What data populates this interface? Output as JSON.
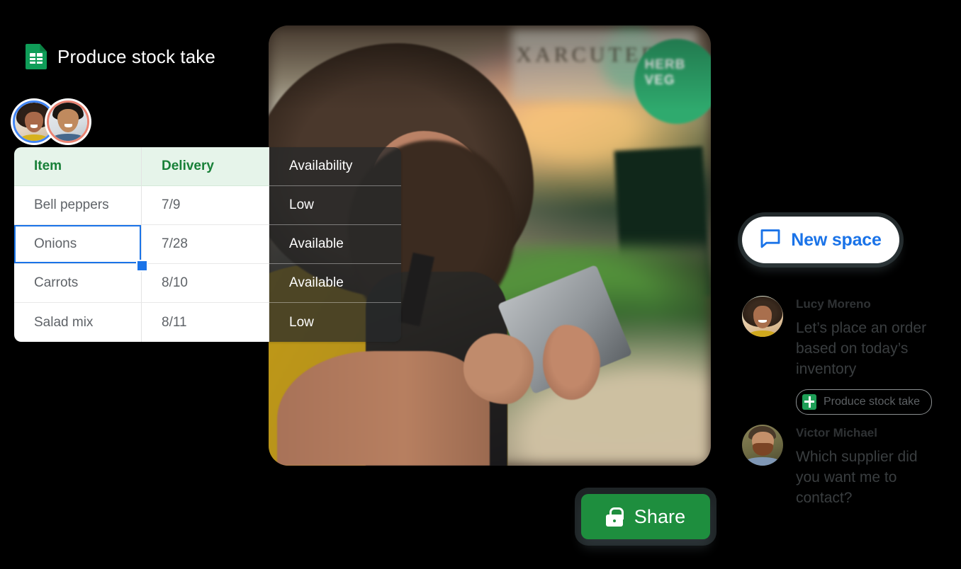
{
  "document": {
    "icon": "google-sheets-icon",
    "title": "Produce stock take"
  },
  "sheet": {
    "columns": [
      "Item",
      "Delivery",
      "Availability"
    ],
    "rows": [
      {
        "item": "Bell peppers",
        "delivery": "7/9",
        "availability": "Low"
      },
      {
        "item": "Onions",
        "delivery": "7/28",
        "availability": "Available"
      },
      {
        "item": "Carrots",
        "delivery": "8/10",
        "availability": "Available"
      },
      {
        "item": "Salad mix",
        "delivery": "8/11",
        "availability": "Low"
      }
    ],
    "selected_row_index": 1,
    "selection_color": "#1a73e8",
    "header_background": "#e6f4ea",
    "header_text_color": "#188038"
  },
  "collaborators": [
    {
      "name": "collaborator-1",
      "ring_color": "#4285f4"
    },
    {
      "name": "collaborator-2",
      "ring_color": "#ea8372"
    }
  ],
  "new_space_button": {
    "label": "New space",
    "icon": "chat-bubble-icon",
    "text_color": "#1a73e8"
  },
  "chat": {
    "messages": [
      {
        "author": "Lucy Moreno",
        "text": "Let’s place an order based on today’s inventory",
        "attachment": {
          "label": "Produce stock take",
          "icon": "google-sheets-icon"
        }
      },
      {
        "author": "Victor Michael",
        "text": "Which supplier did you want me to contact?"
      }
    ]
  },
  "share_button": {
    "label": "Share",
    "icon": "lock-icon",
    "background": "#1e8e3e"
  },
  "photo": {
    "sign_text": "XARCUTER",
    "badge_text": "HERB VEG"
  }
}
